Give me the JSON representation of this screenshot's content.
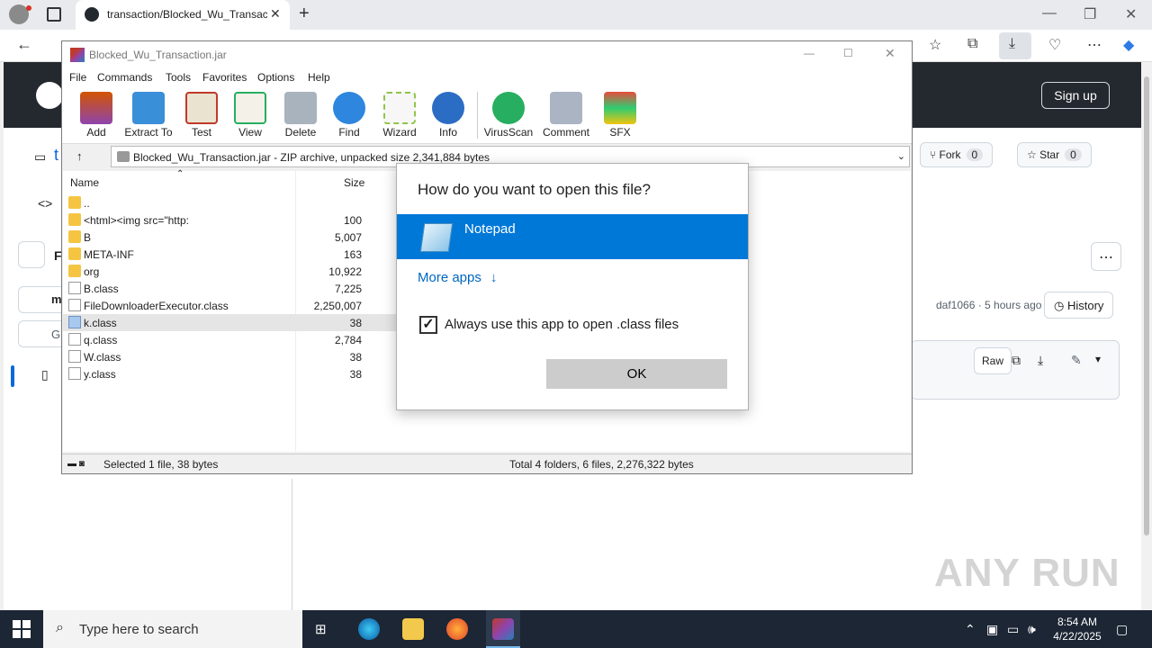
{
  "browser": {
    "tab_title": "transaction/Blocked_Wu_Transac",
    "tab_close": "✕",
    "new_tab": "+",
    "win_minimize": "—",
    "win_restore": "❐",
    "win_close": "✕"
  },
  "github": {
    "signup_label": "Sign up",
    "fork_label": "Fork",
    "fork_count": "0",
    "star_label": "Star",
    "star_count": "0",
    "commit_info": "daf1066 · 5 hours ago",
    "history_label": "History",
    "raw_label": "Raw",
    "partial_letter_t": "t",
    "partial_letter_F": "F",
    "partial_letter_m": "m",
    "partial_letter_G": "G"
  },
  "winrar": {
    "title": "Blocked_Wu_Transaction.jar",
    "menu": [
      "File",
      "Commands",
      "Tools",
      "Favorites",
      "Options",
      "Help"
    ],
    "toolbar": [
      "Add",
      "Extract To",
      "Test",
      "View",
      "Delete",
      "Find",
      "Wizard",
      "Info",
      "VirusScan",
      "Comment",
      "SFX"
    ],
    "path": "Blocked_Wu_Transaction.jar - ZIP archive, unpacked size 2,341,884 bytes",
    "columns": {
      "name": "Name",
      "size": "Size"
    },
    "files": [
      {
        "name": "..",
        "size": "",
        "type": "folder"
      },
      {
        "name": "<html><img src=\"http:",
        "size": "100",
        "type": "folder"
      },
      {
        "name": "B",
        "size": "5,007",
        "type": "folder"
      },
      {
        "name": "META-INF",
        "size": "163",
        "type": "folder"
      },
      {
        "name": "org",
        "size": "10,922",
        "type": "folder"
      },
      {
        "name": "B.class",
        "size": "7,225",
        "type": "file"
      },
      {
        "name": "FileDownloaderExecutor.class",
        "size": "2,250,007",
        "type": "file"
      },
      {
        "name": "k.class",
        "size": "38",
        "type": "file-selected"
      },
      {
        "name": "q.class",
        "size": "2,784",
        "type": "file"
      },
      {
        "name": "W.class",
        "size": "38",
        "type": "file"
      },
      {
        "name": "y.class",
        "size": "38",
        "type": "file"
      }
    ],
    "status_left": "Selected 1 file, 38 bytes",
    "status_right": "Total 4 folders, 6 files, 2,276,322 bytes"
  },
  "dialog": {
    "title": "How do you want to open this file?",
    "app_name": "Notepad",
    "more_apps": "More apps",
    "more_apps_arrow": "↓",
    "checkbox_label": "Always use this app to open .class files",
    "checkbox_mark": "✓",
    "ok_label": "OK"
  },
  "watermark": "ANY RUN",
  "taskbar": {
    "search_placeholder": "Type here to search",
    "time": "8:54 AM",
    "date": "4/22/2025"
  },
  "colors": {
    "accent": "#0078d7",
    "github_header": "#24292f",
    "taskbar": "#1c2634"
  }
}
